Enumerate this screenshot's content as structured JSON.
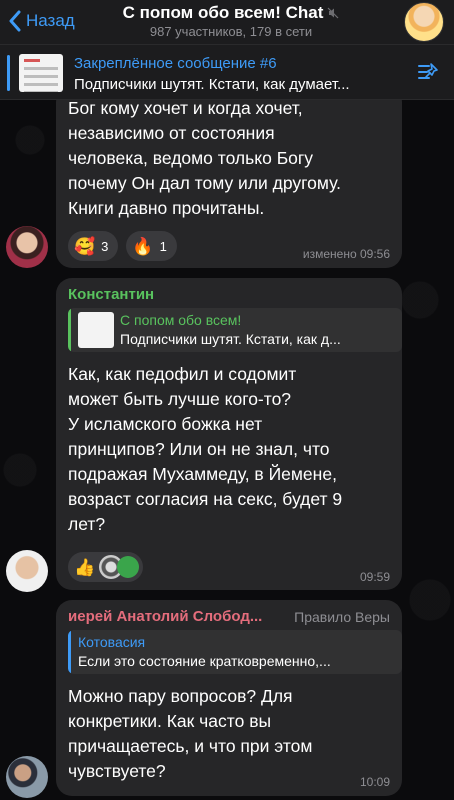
{
  "header": {
    "back_label": "Назад",
    "title": "С попом обо всем! Chat",
    "subtitle": "987 участников, 179 в сети"
  },
  "pinned": {
    "title": "Закреплённое сообщение #6",
    "text": "Подписчики шутят. Кстати, как думает..."
  },
  "messages": [
    {
      "lines": [
        "Бог кому хочет и когда хочет,",
        "независимо от состояния",
        "человека, ведомо только Богу",
        "почему Он дал тому или другому.",
        "Книги давно прочитаны."
      ],
      "reactions": [
        {
          "emoji": "🥰",
          "count": "3"
        },
        {
          "emoji": "🔥",
          "count": "1"
        }
      ],
      "time": "изменено 09:56"
    },
    {
      "sender": "Константин",
      "sender_color": "#59c25e",
      "reply_name": "С попом обо всем!",
      "reply_text": "Подписчики шутят. Кстати, как д...",
      "lines": [
        "Как, как педофил и содомит",
        "может быть лучше кого-то?",
        "У исламского божка нет",
        "принципов? Или он не знал, что",
        "подражая Мухаммеду, в Йемене,",
        "возраст согласия на секс, будет 9",
        "лет?"
      ],
      "reactions": [
        {
          "emoji": "👍",
          "count": ""
        }
      ],
      "time": "09:59"
    },
    {
      "sender": "иерей Анатолий Слобод...",
      "sender_color": "#e46d7c",
      "role": "Правило Веры",
      "reply_name": "Котовасия",
      "reply_text": "Если это состояние кратковременно,...",
      "lines": [
        "Можно пару вопросов? Для",
        "конкретики. Как часто вы",
        "причащаетесь, и что при этом",
        "чувствуете?"
      ],
      "time": "10:09"
    }
  ],
  "colors": {
    "accent": "#3e9bf7",
    "bubble": "#262628",
    "reply_green": "#59c25e",
    "reply_blue": "#3e9bf7"
  }
}
